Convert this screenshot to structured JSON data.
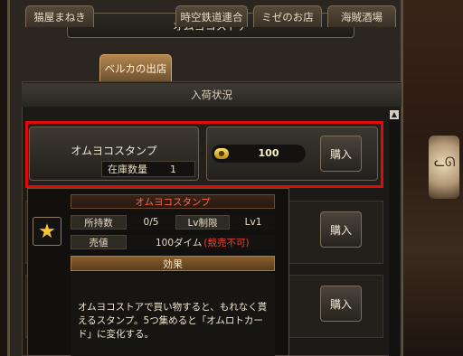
{
  "store_title": "オムヨコストア",
  "tabs": [
    {
      "label": "猫屋まねき"
    },
    {
      "label": "ベルカの出店"
    },
    {
      "label": "時空鉄道連合"
    },
    {
      "label": "ミゼのお店"
    },
    {
      "label": "海賊酒場"
    }
  ],
  "panel_header": "入荷状況",
  "item": {
    "name": "オムヨコスタンプ",
    "stock_label": "在庫数量",
    "stock_value": "1",
    "price": "100",
    "buy_label": "購入"
  },
  "other_rows": [
    {
      "buy_label": "購入"
    },
    {
      "buy_label": "購入"
    }
  ],
  "tooltip": {
    "title": "オムヨコスタンプ",
    "owned_label": "所持数",
    "owned_value": "0/5",
    "level_label": "Lv制限",
    "level_value": "Lv1",
    "sell_label": "売値",
    "sell_value": "100ダイム",
    "sell_note": "(競売不可)",
    "effect_header": "効果",
    "effect_text": "オムヨコストアで買い物すると、もれなく貰えるスタンプ。5つ集めると「オムロトカード」に変化する。"
  },
  "colors": {
    "highlight": "#e00a0a",
    "tooltip_title": "#ff6a4a",
    "sell_note": "#e8402a",
    "coin": "#ffd84a"
  }
}
